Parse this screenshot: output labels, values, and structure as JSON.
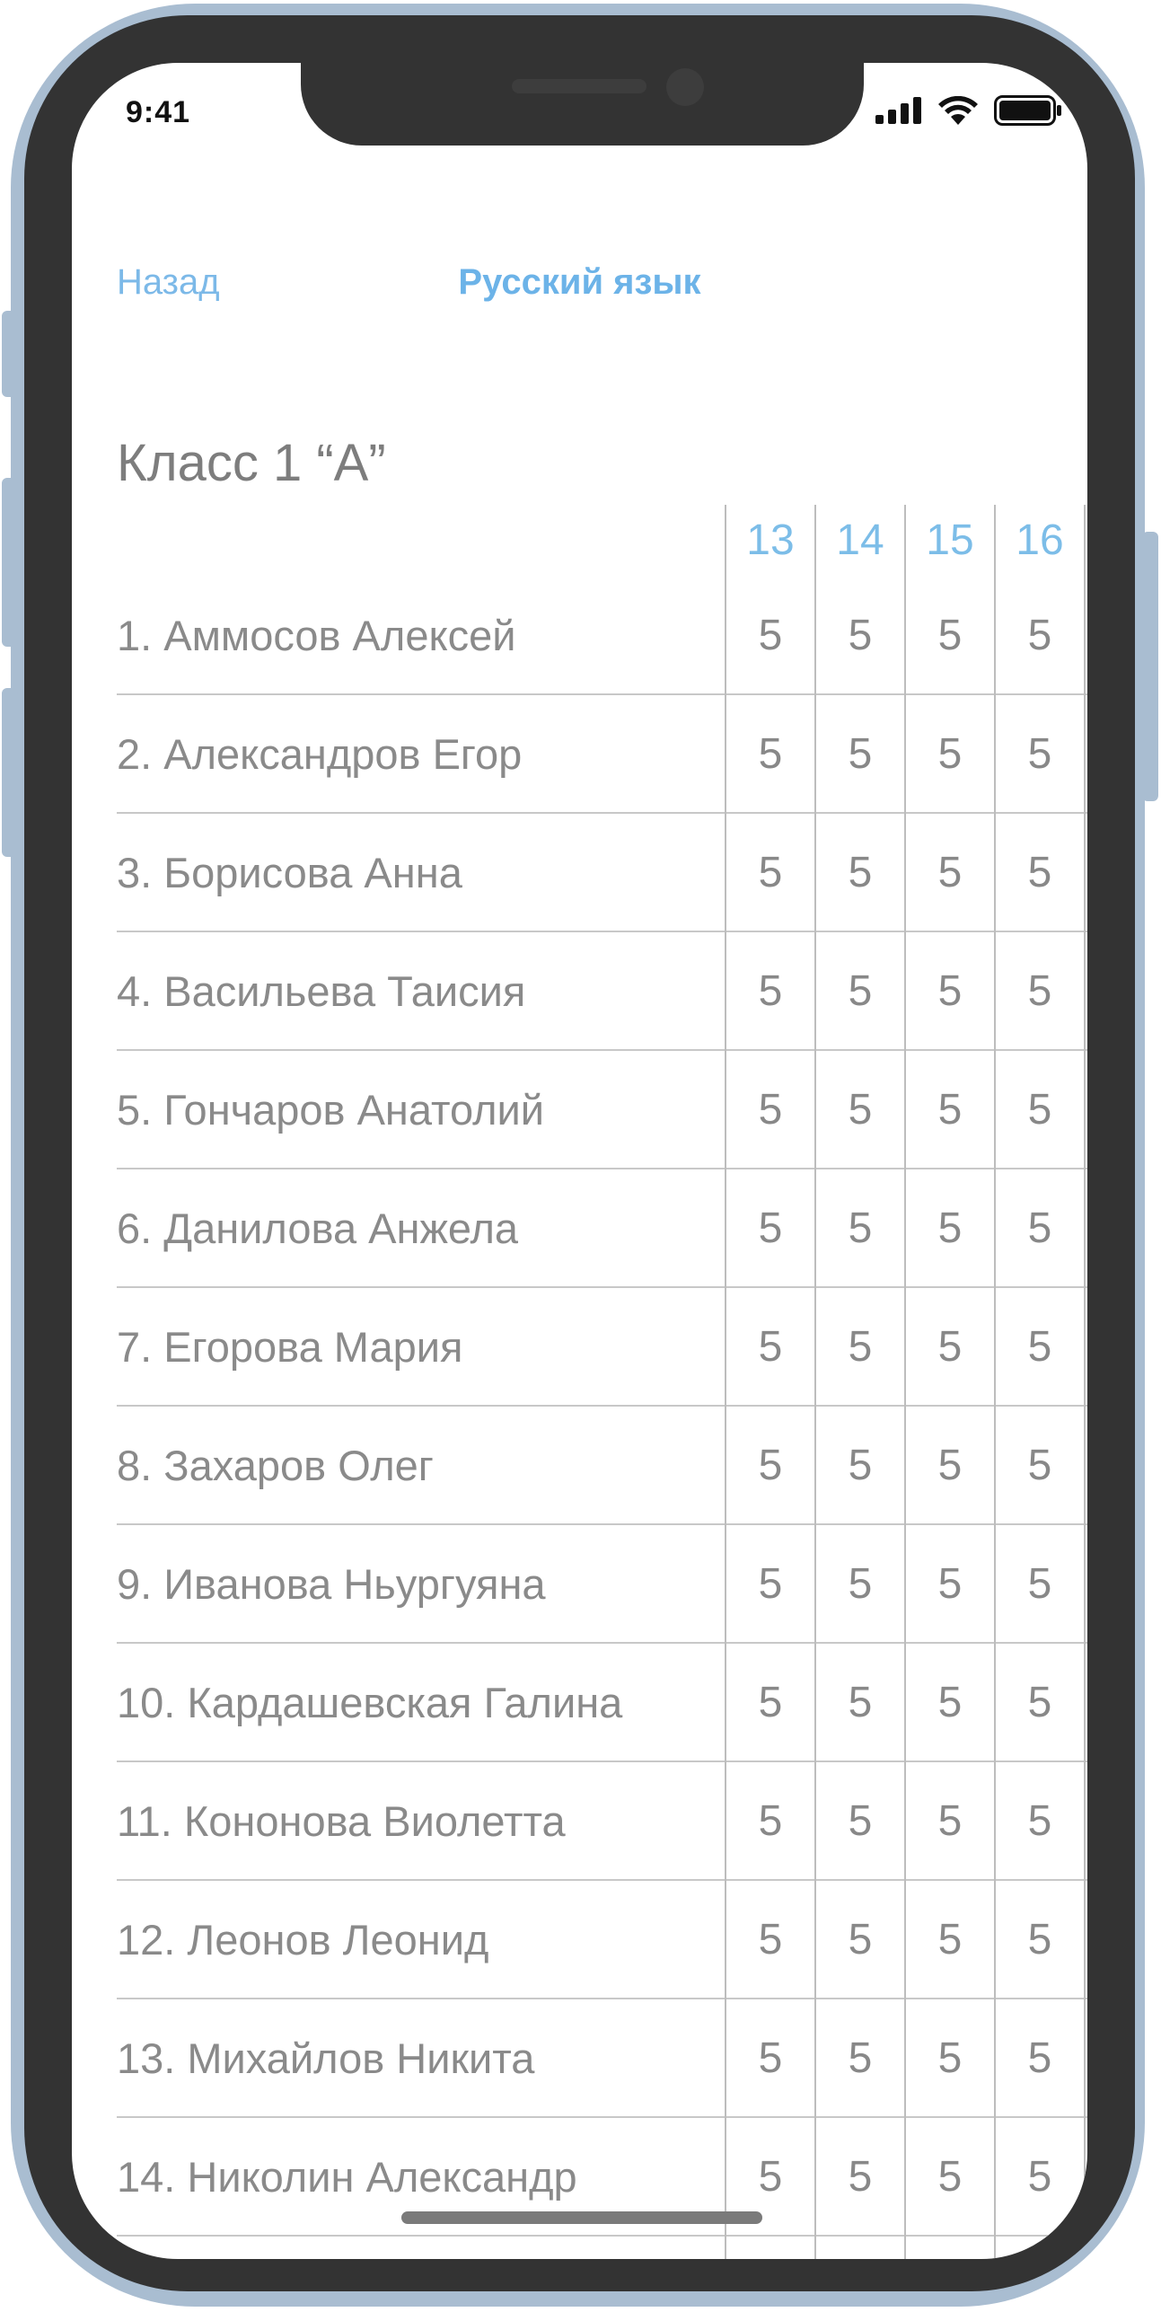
{
  "status_bar": {
    "time": "9:41"
  },
  "nav": {
    "back_label": "Назад",
    "title": "Русский язык"
  },
  "class_title": "Класс 1 “А”",
  "journal": {
    "days": [
      "13",
      "14",
      "15",
      "16"
    ],
    "students": [
      {
        "name": "1. Аммосов Алексей",
        "grades": [
          "5",
          "5",
          "5",
          "5"
        ]
      },
      {
        "name": "2. Александров Егор",
        "grades": [
          "5",
          "5",
          "5",
          "5"
        ]
      },
      {
        "name": "3. Борисова Анна",
        "grades": [
          "5",
          "5",
          "5",
          "5"
        ]
      },
      {
        "name": "4. Васильева Таисия",
        "grades": [
          "5",
          "5",
          "5",
          "5"
        ]
      },
      {
        "name": "5. Гончаров Анатолий",
        "grades": [
          "5",
          "5",
          "5",
          "5"
        ]
      },
      {
        "name": "6. Данилова Анжела",
        "grades": [
          "5",
          "5",
          "5",
          "5"
        ]
      },
      {
        "name": "7. Егорова Мария",
        "grades": [
          "5",
          "5",
          "5",
          "5"
        ]
      },
      {
        "name": "8. Захаров Олег",
        "grades": [
          "5",
          "5",
          "5",
          "5"
        ]
      },
      {
        "name": "9. Иванова Ньургуяна",
        "grades": [
          "5",
          "5",
          "5",
          "5"
        ]
      },
      {
        "name": "10. Кардашевская Галина",
        "grades": [
          "5",
          "5",
          "5",
          "5"
        ]
      },
      {
        "name": "11. Кононова Виолетта",
        "grades": [
          "5",
          "5",
          "5",
          "5"
        ]
      },
      {
        "name": "12. Леонов Леонид",
        "grades": [
          "5",
          "5",
          "5",
          "5"
        ]
      },
      {
        "name": "13. Михайлов Никита",
        "grades": [
          "5",
          "5",
          "5",
          "5"
        ]
      },
      {
        "name": "14. Николин Александр",
        "grades": [
          "5",
          "5",
          "5",
          "5"
        ]
      }
    ]
  },
  "icons": {
    "signal": "cellular-signal-icon",
    "wifi": "wifi-icon",
    "battery": "battery-icon"
  },
  "colors": {
    "accent": "#6cb3e8",
    "frame": "#a9bdd1",
    "bezel": "#333333",
    "text": "#8a8a8a"
  }
}
